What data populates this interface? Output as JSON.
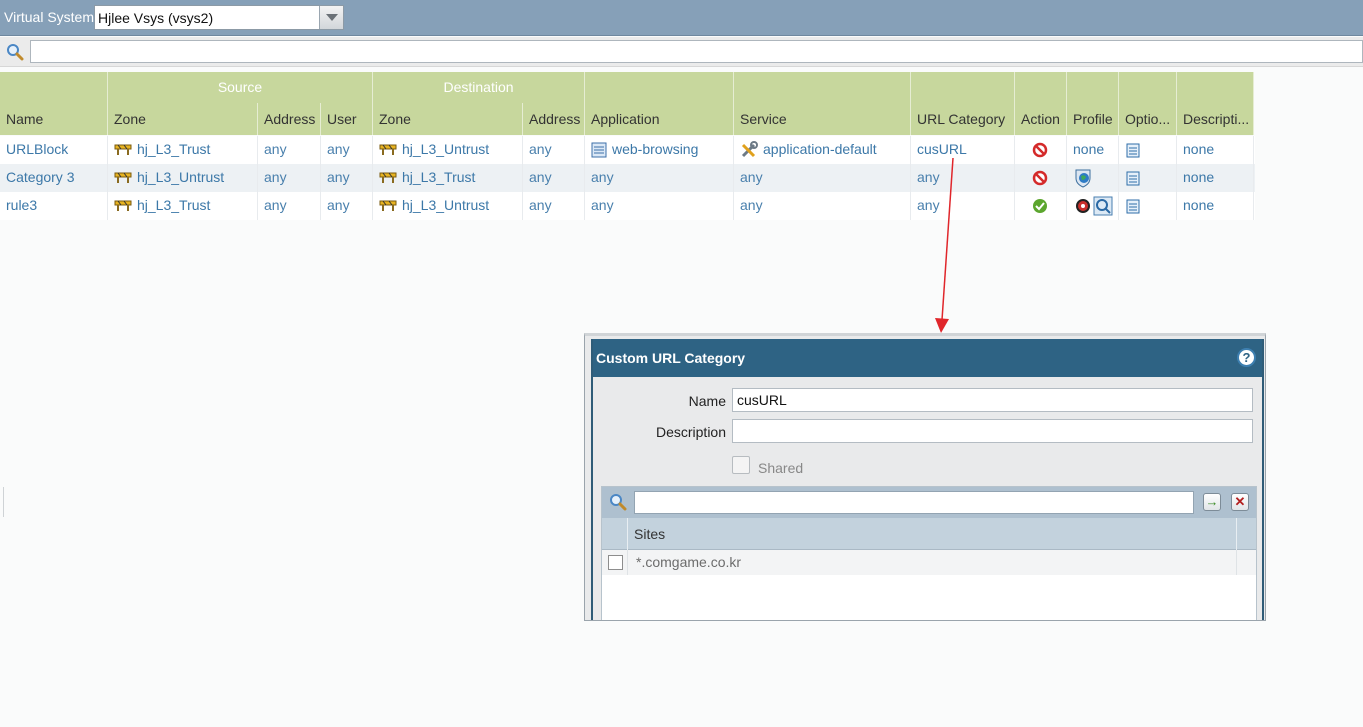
{
  "topbar": {
    "label": "Virtual System",
    "vsys_value": "Hjlee Vsys (vsys2)"
  },
  "search": {
    "placeholder": ""
  },
  "table": {
    "group_headers": {
      "source": "Source",
      "destination": "Destination"
    },
    "columns": {
      "name": "Name",
      "src_zone": "Zone",
      "src_address": "Address",
      "user": "User",
      "dst_zone": "Zone",
      "dst_address": "Address",
      "application": "Application",
      "service": "Service",
      "url_category": "URL Category",
      "action": "Action",
      "profile": "Profile",
      "options": "Optio...",
      "description": "Descripti..."
    },
    "rows": [
      {
        "name": "URLBlock",
        "src_zone": "hj_L3_Trust",
        "src_address": "any",
        "user": "any",
        "dst_zone": "hj_L3_Untrust",
        "dst_address": "any",
        "application": "web-browsing",
        "service": "application-default",
        "url_category": "cusURL",
        "action": "deny",
        "profile": "none",
        "description": "none"
      },
      {
        "name": "Category 3",
        "src_zone": "hj_L3_Untrust",
        "src_address": "any",
        "user": "any",
        "dst_zone": "hj_L3_Trust",
        "dst_address": "any",
        "application": "any",
        "service": "any",
        "url_category": "any",
        "action": "deny",
        "profile": "",
        "description": "none"
      },
      {
        "name": "rule3",
        "src_zone": "hj_L3_Trust",
        "src_address": "any",
        "user": "any",
        "dst_zone": "hj_L3_Untrust",
        "dst_address": "any",
        "application": "any",
        "service": "any",
        "url_category": "any",
        "action": "allow",
        "profile": "",
        "description": "none"
      }
    ]
  },
  "modal": {
    "title": "Custom URL Category",
    "help": "?",
    "name_label": "Name",
    "name_value": "cusURL",
    "description_label": "Description",
    "description_value": "",
    "shared_label": "Shared",
    "sites_header": "Sites",
    "sites": [
      "*.comgame.co.kr"
    ]
  },
  "colors": {
    "header_green": "#c7d79d",
    "modal_title": "#2e6384",
    "link_blue": "#3c78a8",
    "arrow_red": "#e0262b"
  }
}
